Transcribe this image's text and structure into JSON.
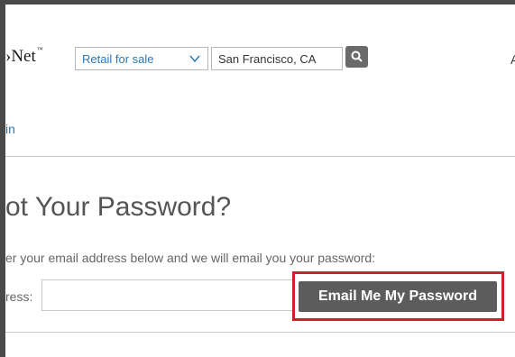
{
  "header": {
    "logo_text": "›Net",
    "logo_mark": "™",
    "property_type": {
      "selected": "Retail for sale"
    },
    "location": {
      "value": "San Francisco, CA"
    },
    "search_icon": "search-icon",
    "right_cut_text": "A"
  },
  "nav": {
    "signin_label": "in"
  },
  "forgot": {
    "title": "ot Your Password?",
    "instructions": "er your email address below and we will email you your password:",
    "email_label": "ress:",
    "email_value": "",
    "submit_label": "Email Me My Password"
  },
  "colors": {
    "accent_link": "#2a78b8",
    "button_bg": "#5c5c5c",
    "highlight_border": "#d0202b"
  }
}
